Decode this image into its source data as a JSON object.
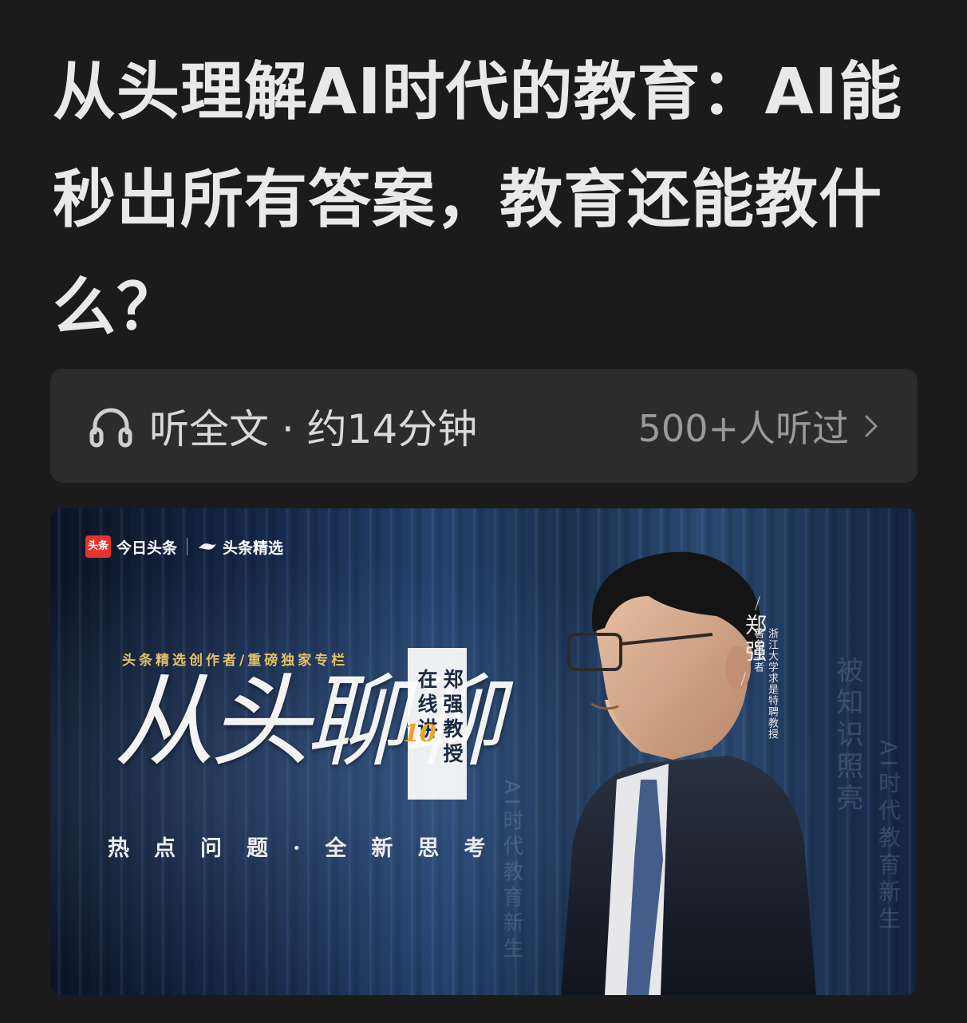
{
  "article": {
    "title": "从头理解AI时代的教育：AI能秒出所有答案，教育还能教什么？"
  },
  "listen": {
    "icon": "headphones-icon",
    "label": "听全文 · 约14分钟",
    "listeners": "500+人听过",
    "chevron_icon": "chevron-right-icon"
  },
  "banner": {
    "logo_toutiao_badge": "头条",
    "logo_toutiao": "今日头条",
    "logo_jingxuan": "头条精选",
    "tagline": "头条精选创作者/重磅独家专栏",
    "big_title": "从头聊聊",
    "vertical_col1": "郑强教授",
    "vertical_col2": "在线讲",
    "vertical_number": "10",
    "subtitle": "热点问题·全新思考",
    "name": "郑强",
    "description_line1": "浙江大学求是特聘教授",
    "description_line2": "著名学者",
    "faint_1": "被知识照亮",
    "faint_2": "AI时代教育新生",
    "faint_3": "AI时代教育新生"
  },
  "colors": {
    "background": "#1b1b1b",
    "listen_bar": "#2c2c2c",
    "banner_accent": "#e6c06a",
    "toutiao_red": "#e9322d"
  }
}
